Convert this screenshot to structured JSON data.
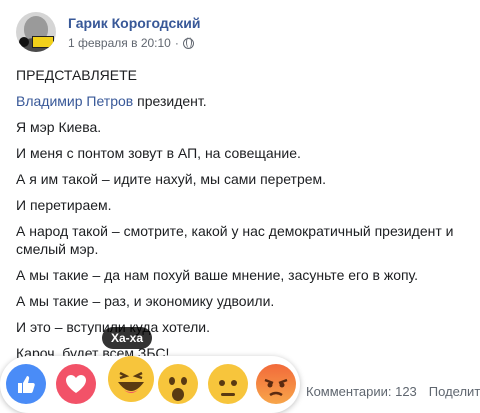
{
  "post": {
    "author": "Гарик Корогодский",
    "date": "1 февраля в 20:10",
    "separator": "·",
    "lines": {
      "l1": "ПРЕДСТАВЛЯЕТЕ",
      "l2_link": "Владимир Петров",
      "l2_rest": " президент.",
      "l3": "Я мэр Киева.",
      "l4": "И меня с понтом зовут в АП, на совещание.",
      "l5": "А я им такой – идите нахуй, мы сами перетрем.",
      "l6": "И перетираем.",
      "l7": "А народ такой – смотрите, какой у нас демократичный президент и смелый мэр.",
      "l8": "А мы такие – да нам похуй ваше мнение, засуньте его в жопу.",
      "l9": "А мы такие – раз, и экономику удвоили.",
      "l10": "И это – вступили куда хотели.",
      "l11": "Кароч, будет всем ЗБС!"
    }
  },
  "reactions": {
    "tooltip": "Ха-ха",
    "items": [
      "like-icon",
      "love-icon",
      "haha-icon",
      "wow-icon",
      "sad-icon",
      "angry-icon"
    ]
  },
  "stats": {
    "comments": "Комментарии: 123",
    "shares": "Поделиться"
  }
}
